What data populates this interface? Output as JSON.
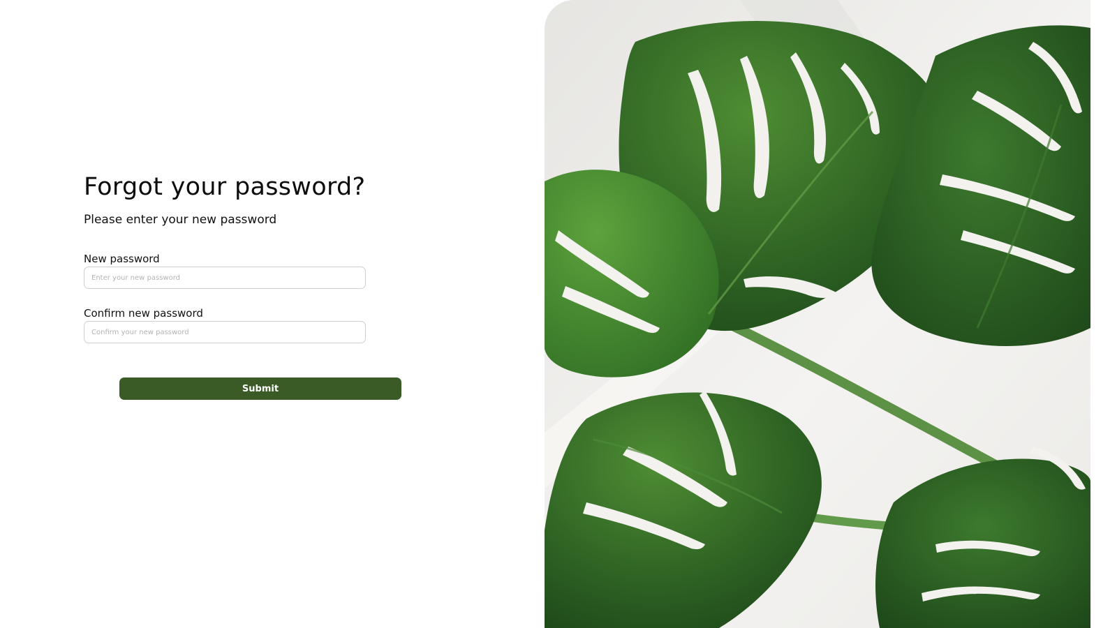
{
  "form": {
    "title": "Forgot your password?",
    "subtitle": "Please enter your new password",
    "new_password": {
      "label": "New password",
      "placeholder": "Enter your new password",
      "value": ""
    },
    "confirm_password": {
      "label": "Confirm new password",
      "placeholder": "Confirm your new password",
      "value": ""
    },
    "submit_label": "Submit"
  },
  "theme": {
    "accent": "#3a5a26",
    "input_border": "#cfcfcf",
    "leaf_dark": "#2a5421",
    "leaf_light": "#4c8a35",
    "photo_bg": "#efefed"
  },
  "image": {
    "icon": "monstera-leaves-photo"
  }
}
